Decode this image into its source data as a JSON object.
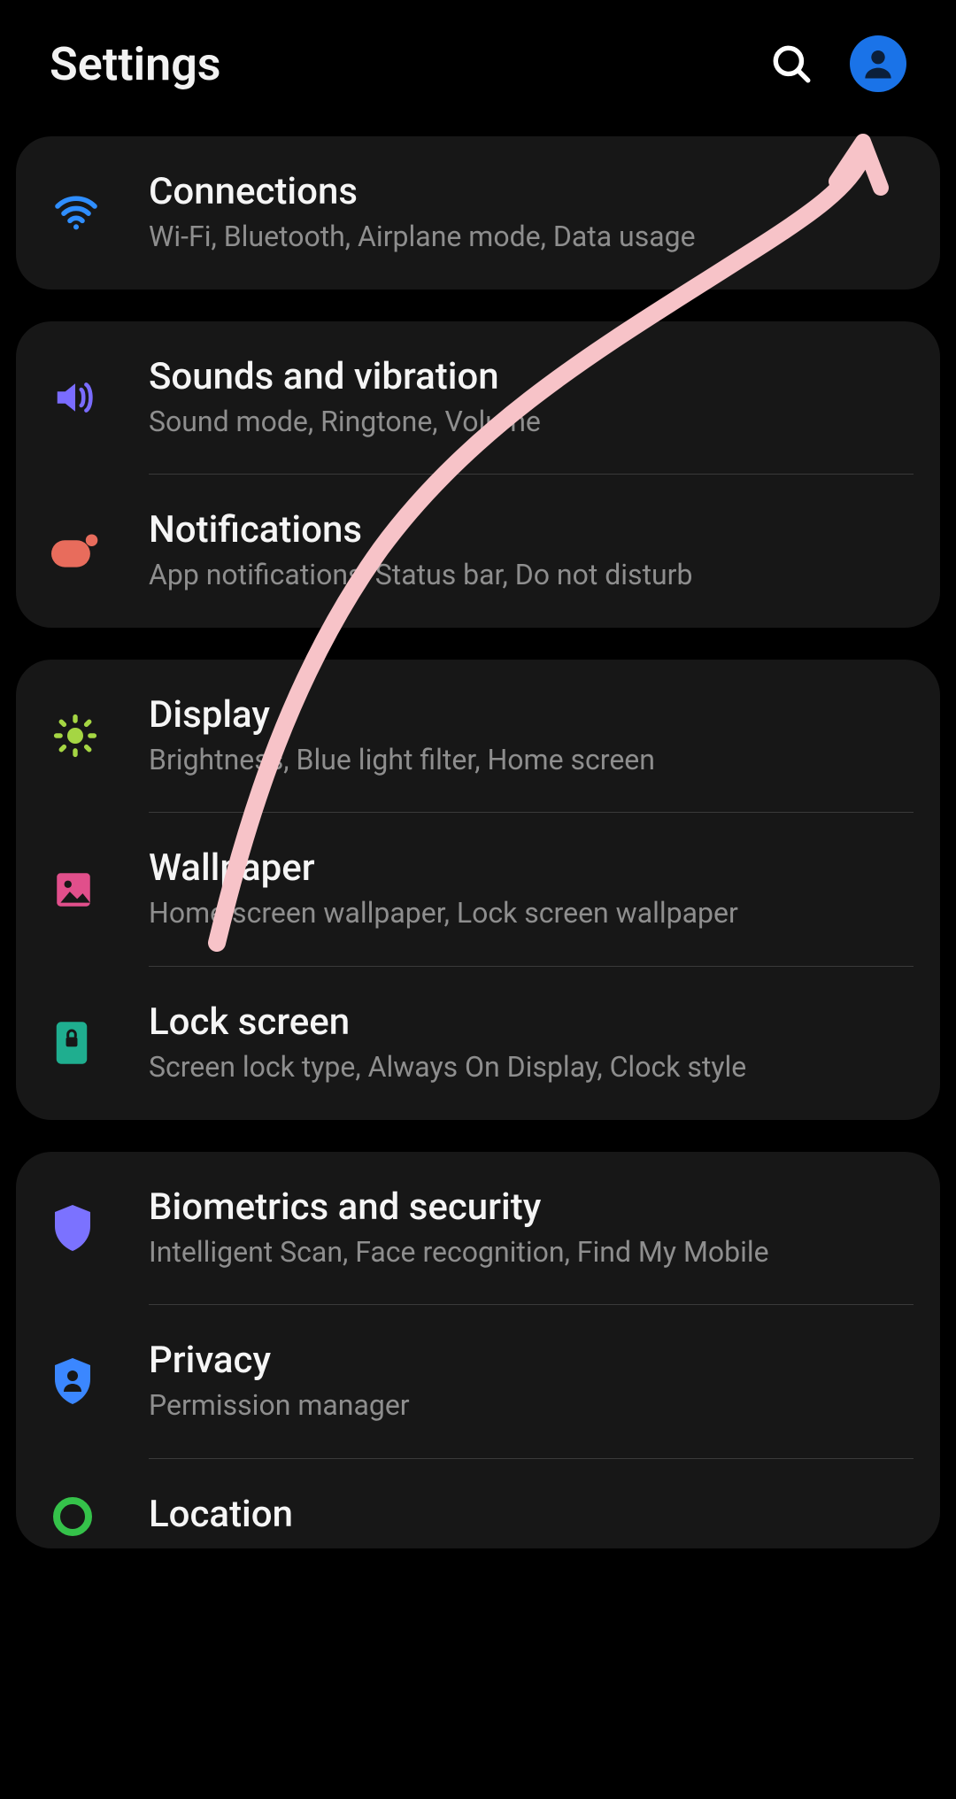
{
  "header": {
    "title": "Settings"
  },
  "groups": [
    {
      "items": [
        {
          "key": "connections",
          "title": "Connections",
          "sub": "Wi-Fi, Bluetooth, Airplane mode, Data usage"
        }
      ]
    },
    {
      "items": [
        {
          "key": "sounds",
          "title": "Sounds and vibration",
          "sub": "Sound mode, Ringtone, Volume"
        },
        {
          "key": "notifications",
          "title": "Notifications",
          "sub": "App notifications, Status bar, Do not disturb"
        }
      ]
    },
    {
      "items": [
        {
          "key": "display",
          "title": "Display",
          "sub": "Brightness, Blue light filter, Home screen"
        },
        {
          "key": "wallpaper",
          "title": "Wallpaper",
          "sub": "Home screen wallpaper, Lock screen wallpaper"
        },
        {
          "key": "lockscreen",
          "title": "Lock screen",
          "sub": "Screen lock type, Always On Display, Clock style"
        }
      ]
    },
    {
      "items": [
        {
          "key": "biometrics",
          "title": "Biometrics and security",
          "sub": "Intelligent Scan, Face recognition, Find My Mobile"
        },
        {
          "key": "privacy",
          "title": "Privacy",
          "sub": "Permission manager"
        },
        {
          "key": "location",
          "title": "Location",
          "sub": ""
        }
      ]
    }
  ]
}
